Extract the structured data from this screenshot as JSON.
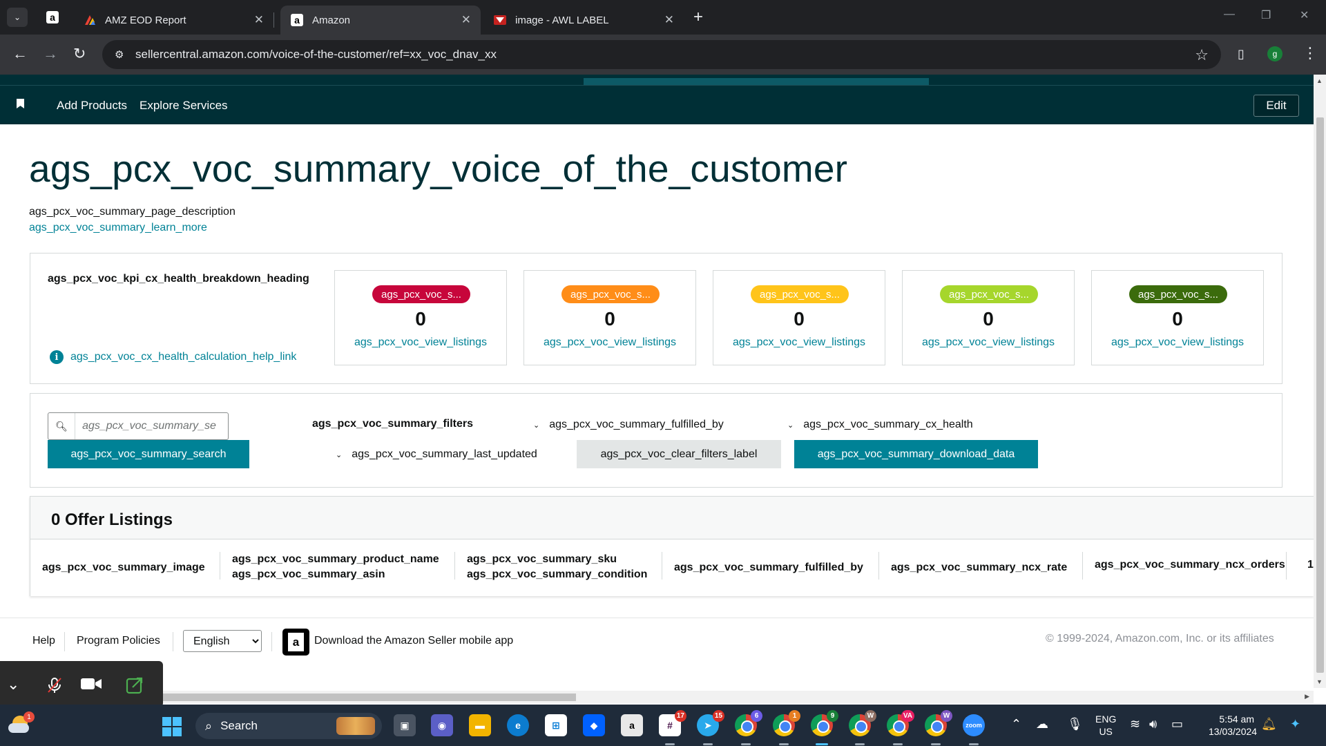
{
  "browser": {
    "tabs": [
      {
        "title": "AMZ EOD Report",
        "active": false
      },
      {
        "title": "Amazon",
        "active": true
      },
      {
        "title": "image - AWL LABEL",
        "active": false
      }
    ],
    "url": "sellercentral.amazon.com/voice-of-the-customer/ref=xx_voc_dnav_xx",
    "profile_initial": "g"
  },
  "nav": {
    "links": [
      "Add Products",
      "Explore Services"
    ],
    "edit_label": "Edit"
  },
  "page": {
    "title": "ags_pcx_voc_summary_voice_of_the_customer",
    "description": "ags_pcx_voc_summary_page_description",
    "learn_more": "ags_pcx_voc_summary_learn_more"
  },
  "kpi": {
    "heading": "ags_pcx_voc_kpi_cx_health_breakdown_heading",
    "help_link": "ags_pcx_voc_cx_health_calculation_help_link",
    "cards": [
      {
        "badge": "ags_pcx_voc_s...",
        "color": "#c7063b",
        "count": "0",
        "link": "ags_pcx_voc_view_listings"
      },
      {
        "badge": "ags_pcx_voc_s...",
        "color": "#ff8d18",
        "count": "0",
        "link": "ags_pcx_voc_view_listings"
      },
      {
        "badge": "ags_pcx_voc_s...",
        "color": "#ffc41a",
        "count": "0",
        "link": "ags_pcx_voc_view_listings"
      },
      {
        "badge": "ags_pcx_voc_s...",
        "color": "#a6d62c",
        "count": "0",
        "link": "ags_pcx_voc_view_listings"
      },
      {
        "badge": "ags_pcx_voc_s...",
        "color": "#3b6b0c",
        "count": "0",
        "link": "ags_pcx_voc_view_listings"
      }
    ]
  },
  "filters": {
    "search_placeholder": "ags_pcx_voc_summary_se",
    "search_button": "ags_pcx_voc_summary_search",
    "label": "ags_pcx_voc_summary_filters",
    "fulfilled_by": "ags_pcx_voc_summary_fulfilled_by",
    "cx_health": "ags_pcx_voc_summary_cx_health",
    "last_updated": "ags_pcx_voc_summary_last_updated",
    "clear_button": "ags_pcx_voc_clear_filters_label",
    "download_button": "ags_pcx_voc_summary_download_data"
  },
  "listings": {
    "title": "0 Offer Listings",
    "columns": [
      {
        "line1": "ags_pcx_voc_summary_image",
        "line2": ""
      },
      {
        "line1": "ags_pcx_voc_summary_product_name",
        "line2": "ags_pcx_voc_summary_asin"
      },
      {
        "line1": "ags_pcx_voc_summary_sku",
        "line2": "ags_pcx_voc_summary_condition"
      },
      {
        "line1": "ags_pcx_voc_summary_fulfilled_by",
        "line2": ""
      },
      {
        "line1": "ags_pcx_voc_summary_ncx_rate",
        "line2": ""
      },
      {
        "line1": "ags_pcx_voc_summary_ncx_orders",
        "line2": ""
      },
      {
        "line1": "1",
        "line2": ""
      }
    ]
  },
  "footer": {
    "help": "Help",
    "policies": "Program Policies",
    "language": "English",
    "app_text": "Download the Amazon Seller mobile app",
    "copyright": "© 1999-2024, Amazon.com, Inc. or its affiliates"
  },
  "taskbar": {
    "search_label": "Search",
    "lang_line1": "ENG",
    "lang_line2": "US",
    "time": "5:54 am",
    "date": "13/03/2024",
    "weather_badge": "1",
    "badges": {
      "slack": "17",
      "telegram": "15",
      "chrome1": "6",
      "chrome2": "1",
      "chrome3": "9",
      "chrome4": "W",
      "chrome5": "VA",
      "chrome6": "W"
    }
  }
}
